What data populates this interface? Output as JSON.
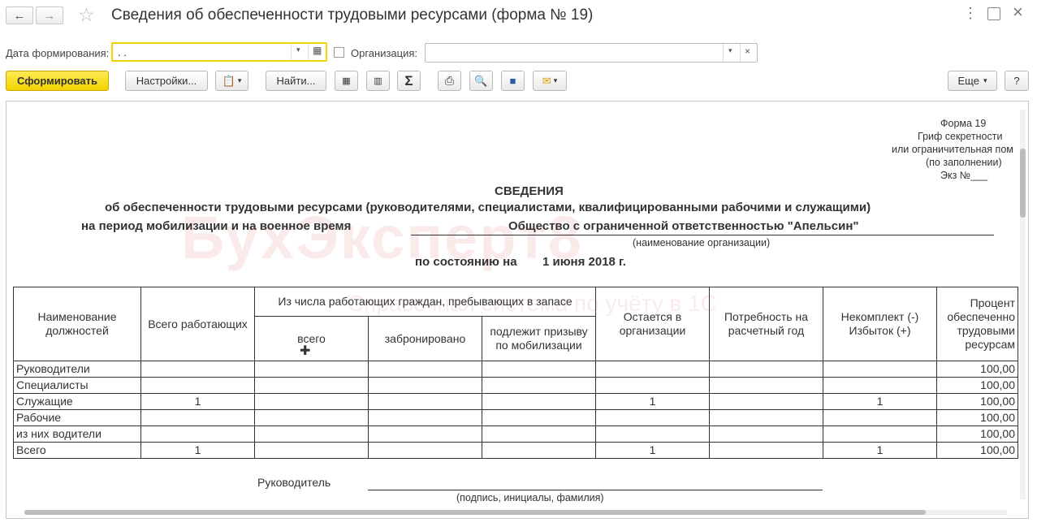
{
  "window": {
    "title": "Сведения об обеспеченности трудовыми ресурсами (форма № 19)"
  },
  "filters": {
    "date_label": "Дата формирования:",
    "date_value": " . .",
    "org_label": "Организация:",
    "org_value": ""
  },
  "toolbar": {
    "generate": "Сформировать",
    "settings": "Настройки...",
    "find": "Найти...",
    "more": "Еще",
    "help": "?"
  },
  "report": {
    "form_block": [
      "Форма 19",
      "Гриф секретности",
      "или ограничительная пом",
      "(по заполнении)",
      "Экз №___"
    ],
    "heading": "СВЕДЕНИЯ",
    "subheading": "об обеспеченности трудовыми ресурсами (руководителями, специалистами, квалифицированными рабочими и служащими)",
    "period": "на период мобилизации и на военное время",
    "org_name": "Общество с ограниченной ответственностью \"Апельсин\"",
    "org_caption": "(наименование организации)",
    "as_of_label": "по состоянию на",
    "as_of_date": "1 июня 2018 г.",
    "columns": {
      "position": "Наименование должностей",
      "total_employees": "Всего работающих",
      "reserve_group": "Из числа работающих граждан, пребывающих в запасе",
      "reserve_total": "всего",
      "reserved": "забронировано",
      "to_mobilize": "подлежит призыву по мобилизации",
      "remains": "Остается в организации",
      "need": "Потребность на расчетный год",
      "shortage": "Некомплект (-) Избыток (+)",
      "percent": "Процент обеспеченно трудовыми ресурсам"
    },
    "rows": [
      {
        "name": "Руководители",
        "total": "",
        "reserve_total": "",
        "reserved": "",
        "to_mobilize": "",
        "remains": "",
        "need": "",
        "shortage": "",
        "percent": "100,00"
      },
      {
        "name": "Специалисты",
        "total": "",
        "reserve_total": "",
        "reserved": "",
        "to_mobilize": "",
        "remains": "",
        "need": "",
        "shortage": "",
        "percent": "100,00"
      },
      {
        "name": "Служащие",
        "total": "1",
        "reserve_total": "",
        "reserved": "",
        "to_mobilize": "",
        "remains": "1",
        "need": "",
        "shortage": "1",
        "percent": "100,00"
      },
      {
        "name": "Рабочие",
        "total": "",
        "reserve_total": "",
        "reserved": "",
        "to_mobilize": "",
        "remains": "",
        "need": "",
        "shortage": "",
        "percent": "100,00"
      },
      {
        "name": "из них водители",
        "total": "",
        "reserve_total": "",
        "reserved": "",
        "to_mobilize": "",
        "remains": "",
        "need": "",
        "shortage": "",
        "percent": "100,00"
      },
      {
        "name": "Всего",
        "total": "1",
        "reserve_total": "",
        "reserved": "",
        "to_mobilize": "",
        "remains": "1",
        "need": "",
        "shortage": "1",
        "percent": "100,00"
      }
    ],
    "signature_label": "Руководитель",
    "signature_caption": "(подпись, инициалы, фамилия)"
  },
  "watermark": {
    "brand": "БухЭксперт8",
    "tagline": "Справочная система по учёту в 1С"
  }
}
